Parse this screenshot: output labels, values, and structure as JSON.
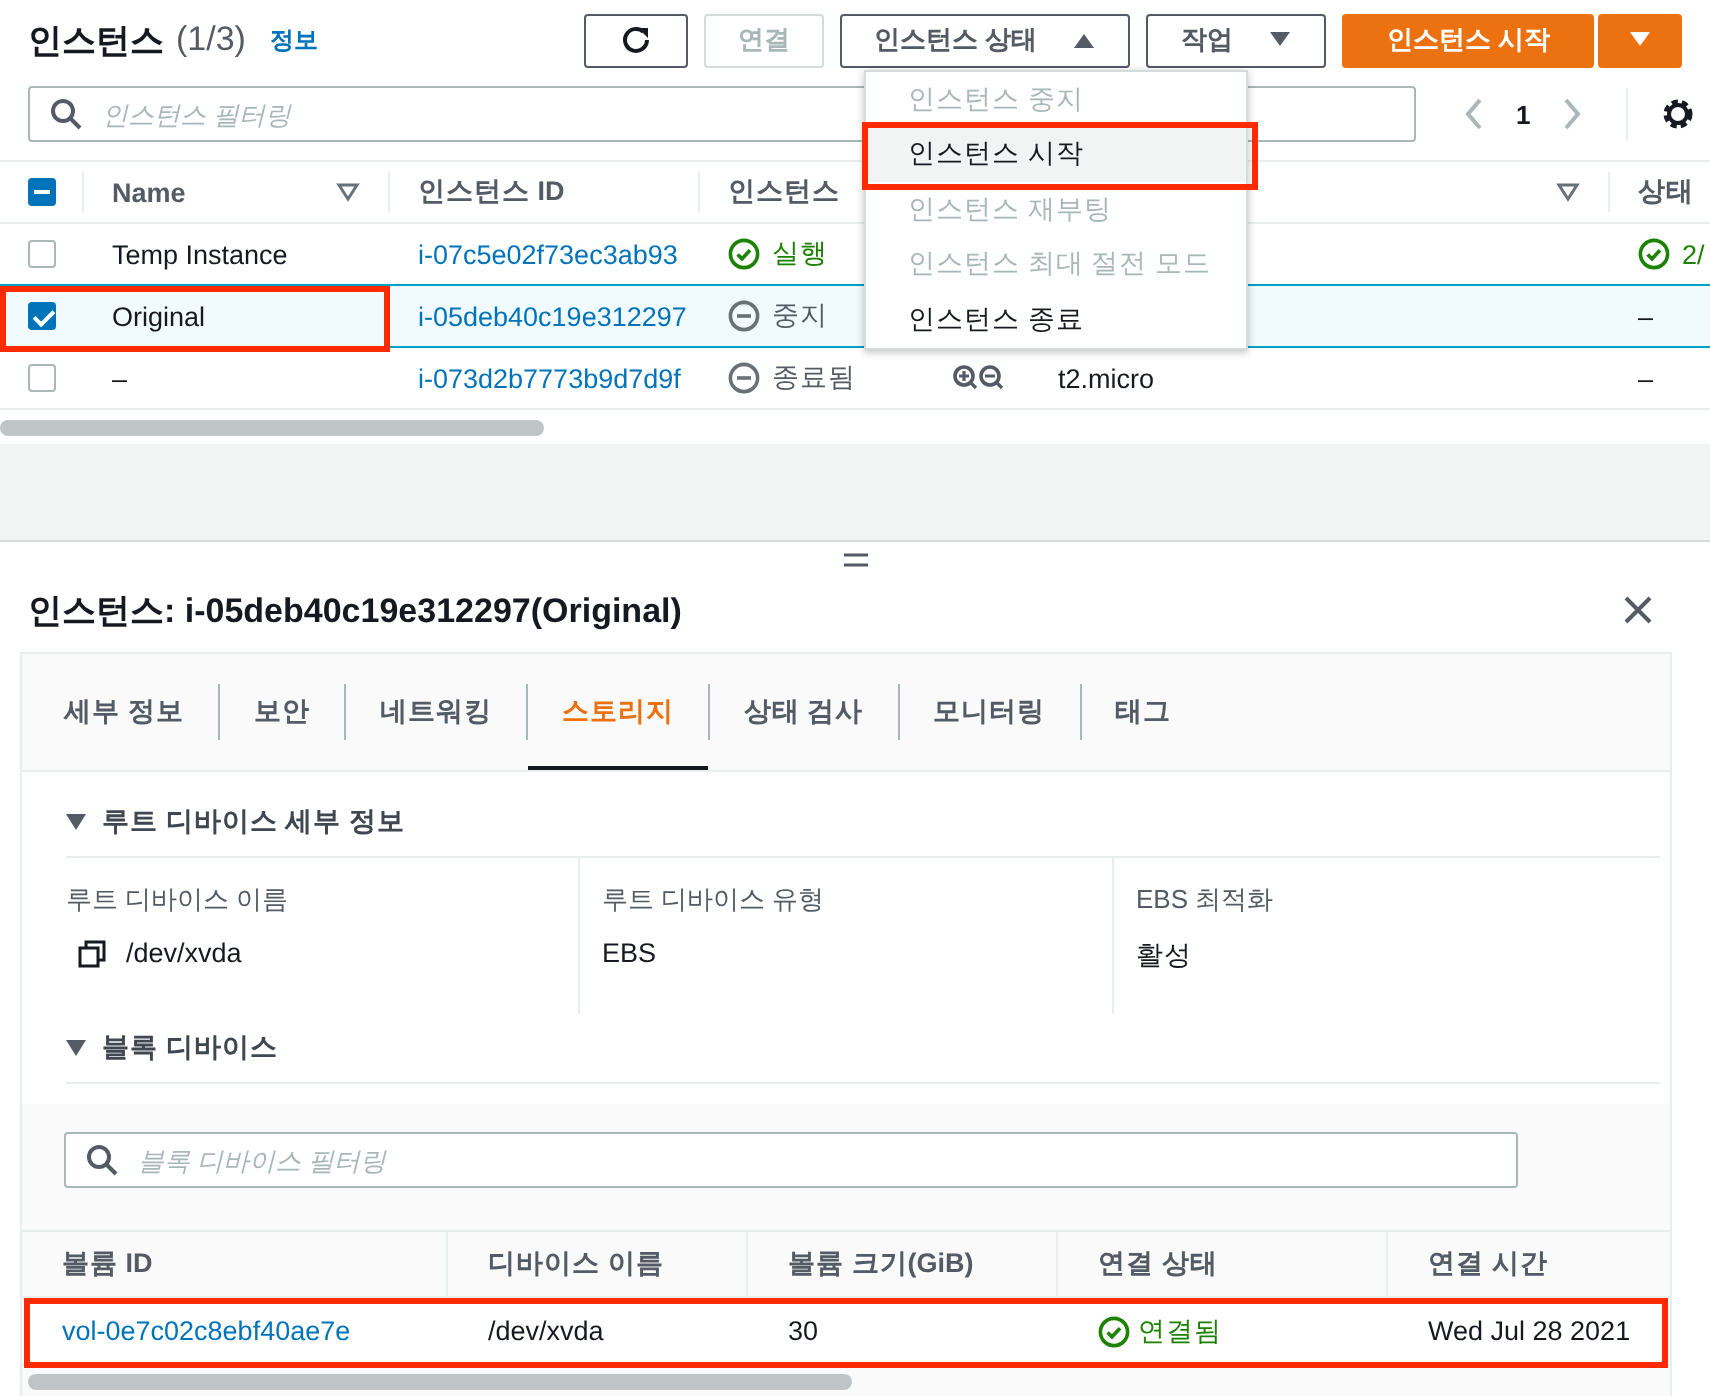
{
  "header": {
    "title": "인스턴스",
    "count": "(1/3)",
    "info_link": "정보"
  },
  "toolbar": [
    {
      "kind": "refresh",
      "disabled": false
    },
    {
      "kind": "plain",
      "label": "연결",
      "disabled": true
    },
    {
      "kind": "dropdown",
      "label": "인스턴스 상태",
      "expanded": true
    },
    {
      "kind": "dropdown",
      "label": "작업",
      "expanded": false
    },
    {
      "kind": "primary",
      "label": "인스턴스 시작"
    },
    {
      "kind": "primary-caret"
    }
  ],
  "filter": {
    "placeholder": "인스턴스 필터링"
  },
  "pagination": {
    "page": "1"
  },
  "instances": {
    "header_checkbox": {
      "indeterminate": true
    },
    "columns": [
      {
        "label": "Name",
        "sortable": true
      },
      {
        "label": "인스턴스 ID",
        "sortable": false
      },
      {
        "label": "인스턴스"
      },
      {
        "sortable": true
      },
      {
        "label": "상태",
        "sortable": false
      }
    ],
    "rows": [
      {
        "checked": false,
        "selected": false,
        "annotated": false,
        "name": "Temp Instance",
        "id": "i-07c5e02f73ec3ab93",
        "state": {
          "kind": "running",
          "label": "실행"
        },
        "check": {
          "kind": "passed",
          "label": "2/"
        }
      },
      {
        "checked": true,
        "selected": true,
        "annotated": true,
        "name": "Original",
        "id": "i-05deb40c19e312297",
        "state": {
          "kind": "stopped",
          "label": "중지"
        },
        "check": {
          "kind": "none",
          "label": "–"
        }
      },
      {
        "checked": false,
        "selected": false,
        "annotated": false,
        "name": "–",
        "id": "i-073d2b7773b9d7d9f",
        "state": {
          "kind": "stopped",
          "label": "종료됨"
        },
        "zoom_icons": true,
        "type": "t2.micro",
        "check": {
          "kind": "none",
          "label": "–"
        }
      }
    ]
  },
  "menu": [
    {
      "label": "인스턴스 중지",
      "disabled": true,
      "selected": false,
      "annotated": false
    },
    {
      "label": "인스턴스 시작",
      "disabled": false,
      "selected": true,
      "annotated": true
    },
    {
      "label": "인스턴스 재부팅",
      "disabled": true,
      "selected": false,
      "annotated": false
    },
    {
      "label": "인스턴스 최대 절전 모드",
      "disabled": true,
      "selected": false,
      "annotated": false
    },
    {
      "label": "인스턴스 종료",
      "disabled": false,
      "selected": false,
      "annotated": false
    }
  ],
  "detail": {
    "title": "인스턴스: i-05deb40c19e312297(Original)",
    "tabs": [
      {
        "label": "세부 정보",
        "selected": false
      },
      {
        "label": "보안",
        "selected": false
      },
      {
        "label": "네트워킹",
        "selected": false
      },
      {
        "label": "스토리지",
        "selected": true
      },
      {
        "label": "상태 검사",
        "selected": false
      },
      {
        "label": "모니터링",
        "selected": false
      },
      {
        "label": "태그",
        "selected": false
      }
    ],
    "root_device": {
      "title": "루트 디바이스 세부 정보",
      "expanded": true,
      "fields": [
        {
          "label": "루트 디바이스 이름",
          "value": "/dev/xvda",
          "copyable": true
        },
        {
          "label": "루트 디바이스 유형",
          "value": "EBS",
          "copyable": false
        },
        {
          "label": "EBS 최적화",
          "value": "활성",
          "copyable": false
        }
      ]
    },
    "block_devices": {
      "title": "블록 디바이스",
      "expanded": true,
      "filter_placeholder": "블록 디바이스 필터링",
      "columns": [
        "볼륨 ID",
        "디바이스 이름",
        "볼륨 크기(GiB)",
        "연결 상태",
        "연결 시간"
      ],
      "rows": [
        {
          "annotated": true,
          "volume_id": "vol-0e7c02c8ebf40ae7e",
          "device": "/dev/xvda",
          "size": "30",
          "status": {
            "kind": "attached",
            "label": "연결됨"
          },
          "time": "Wed Jul 28 2021"
        }
      ]
    }
  }
}
